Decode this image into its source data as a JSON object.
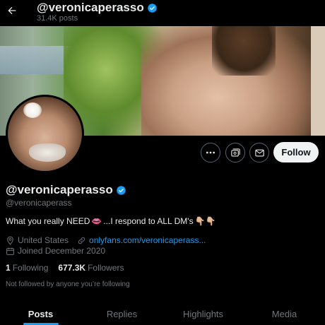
{
  "header": {
    "title": "@veronicaperasso",
    "subtitle": "31.4K posts",
    "icons": {
      "back": "arrow-left-icon",
      "verified": "verified-badge-icon"
    }
  },
  "banner": {
    "description_icon": "banner-image"
  },
  "actions": {
    "more_icon": "more-horizontal-icon",
    "subscribe_icon": "subscribe-icon",
    "message_icon": "envelope-icon",
    "follow_label": "Follow"
  },
  "profile": {
    "display_name": "@veronicaperasso",
    "handle": "@veronicaperass",
    "bio_start": "What you really NEED",
    "bio_emoji_1": "👄",
    "bio_mid": "...I respond to ALL DM's",
    "bio_emoji_2": "👇🏼👇🏼",
    "location": "United States",
    "website": "onlyfans.com/veronicaperass...",
    "joined": "Joined December 2020",
    "following_count": "1",
    "following_label": "Following",
    "followers_count": "677.3K",
    "followers_label": "Followers",
    "not_followed": "Not followed by anyone you’re following"
  },
  "tabs": [
    {
      "label": "Posts",
      "active": true
    },
    {
      "label": "Replies",
      "active": false
    },
    {
      "label": "Highlights",
      "active": false
    },
    {
      "label": "Media",
      "active": false
    }
  ],
  "colors": {
    "accent": "#1d9bf0",
    "background": "#000000",
    "text": "#e7e9ea",
    "muted": "#71767b",
    "follow_bg": "#eff3f4"
  }
}
